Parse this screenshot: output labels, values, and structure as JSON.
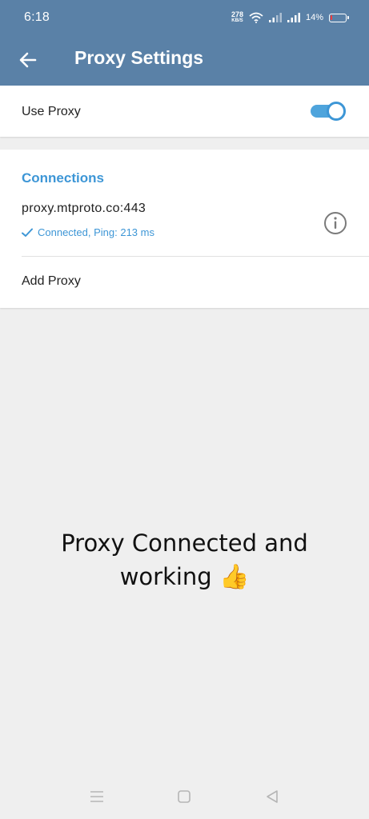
{
  "status_bar": {
    "time": "6:18",
    "net_speed_value": "278",
    "net_speed_unit": "KB/S",
    "battery_percent": "14%",
    "battery_level": 0.14,
    "battery_color": "#ff3b3b"
  },
  "app_bar": {
    "title": "Proxy Settings",
    "back_icon": "arrow-left-icon",
    "color": "#5a81a7"
  },
  "use_proxy": {
    "label": "Use Proxy",
    "enabled": true,
    "accent": "#3d96d6"
  },
  "connections": {
    "title": "Connections",
    "items": [
      {
        "host": "proxy.mtproto.co:443",
        "status": "Connected, Ping: 213 ms",
        "status_icon": "checkmark-icon",
        "action_icon": "info-icon"
      }
    ],
    "add_label": "Add Proxy"
  },
  "caption": {
    "text_line1": "Proxy Connected and",
    "text_line2": "working",
    "emoji": "👍"
  },
  "nav_bar": {
    "icons": [
      "menu-icon",
      "home-square-icon",
      "back-triangle-icon"
    ]
  }
}
